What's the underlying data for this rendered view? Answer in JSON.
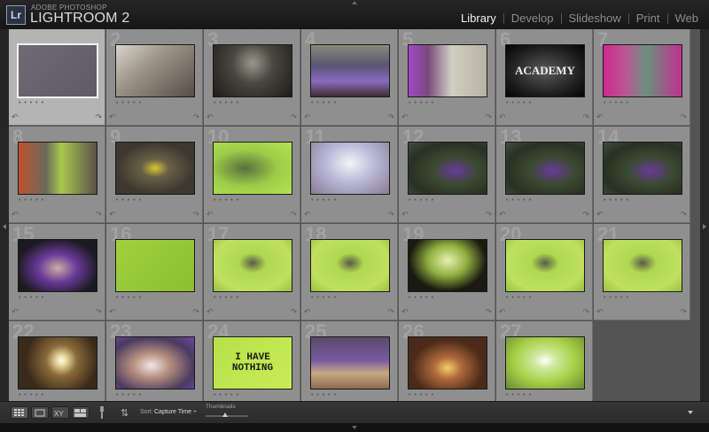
{
  "app": {
    "logo": "Lr",
    "company": "ADOBE PHOTOSHOP",
    "name": "LIGHTROOM 2"
  },
  "modules": [
    {
      "label": "Library",
      "active": true
    },
    {
      "label": "Develop",
      "active": false
    },
    {
      "label": "Slideshow",
      "active": false
    },
    {
      "label": "Print",
      "active": false
    },
    {
      "label": "Web",
      "active": false
    }
  ],
  "grid": {
    "cells": [
      {
        "index": "",
        "selected": true,
        "theme": "gray-grid",
        "overlay": ""
      },
      {
        "index": "2",
        "theme": "stairs-bag",
        "overlay": ""
      },
      {
        "index": "3",
        "theme": "corridor-dark",
        "overlay": ""
      },
      {
        "index": "4",
        "theme": "stairs-purple",
        "overlay": ""
      },
      {
        "index": "5",
        "theme": "hallway-purple",
        "overlay": ""
      },
      {
        "index": "6",
        "theme": "club-sign",
        "overlay": "ACADEMY"
      },
      {
        "index": "7",
        "theme": "pink-room",
        "overlay": ""
      },
      {
        "index": "8",
        "theme": "doors-green",
        "overlay": ""
      },
      {
        "index": "9",
        "theme": "bottle",
        "overlay": ""
      },
      {
        "index": "10",
        "theme": "green-object",
        "overlay": ""
      },
      {
        "index": "11",
        "theme": "hand-ball",
        "overlay": ""
      },
      {
        "index": "12",
        "theme": "woman-park",
        "overlay": ""
      },
      {
        "index": "13",
        "theme": "woman-park",
        "overlay": ""
      },
      {
        "index": "14",
        "theme": "woman-park",
        "overlay": ""
      },
      {
        "index": "15",
        "theme": "portrait-dark",
        "overlay": ""
      },
      {
        "index": "16",
        "theme": "green-wall",
        "overlay": ""
      },
      {
        "index": "17",
        "theme": "dancer-green",
        "overlay": ""
      },
      {
        "index": "18",
        "theme": "dancer-green",
        "overlay": ""
      },
      {
        "index": "19",
        "theme": "studio-dark",
        "overlay": ""
      },
      {
        "index": "20",
        "theme": "dancer-green",
        "overlay": ""
      },
      {
        "index": "21",
        "theme": "dancer-green",
        "overlay": ""
      },
      {
        "index": "22",
        "theme": "chandelier",
        "overlay": ""
      },
      {
        "index": "23",
        "theme": "phone-pose",
        "overlay": ""
      },
      {
        "index": "24",
        "theme": "sign-green",
        "overlay": "I HAVE\nNOTHING"
      },
      {
        "index": "25",
        "theme": "cat-box",
        "overlay": ""
      },
      {
        "index": "26",
        "theme": "doorway",
        "overlay": ""
      },
      {
        "index": "27",
        "theme": "sign-hold",
        "overlay": ""
      }
    ]
  },
  "toolbar": {
    "sort_label": "Sort:",
    "sort_value": "Capture Time",
    "thumbnails_label": "Thumbnails",
    "thumbnail_size": 0.45
  },
  "colors": {
    "cell": "#8f8f8f",
    "cell_selected": "#b4b4b4",
    "accent_green": "#b6e04a"
  }
}
